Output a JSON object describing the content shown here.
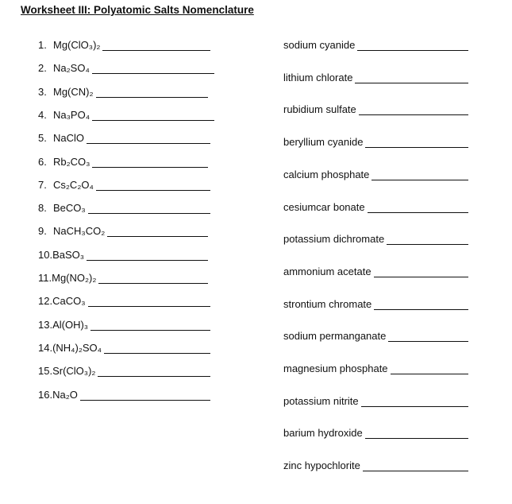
{
  "title": "Worksheet III:  Polyatomic Salts Nomenclature",
  "formulas": [
    {
      "num": "1.",
      "text": "Mg(ClO₃)₂"
    },
    {
      "num": "2.",
      "text": "Na₂SO₄"
    },
    {
      "num": "3.",
      "text": "Mg(CN)₂"
    },
    {
      "num": "4.",
      "text": "Na₃PO₄"
    },
    {
      "num": "5.",
      "text": "NaClO"
    },
    {
      "num": "6.",
      "text": "Rb₂CO₃"
    },
    {
      "num": "7.",
      "text": "Cs₂C₂O₄"
    },
    {
      "num": "8.",
      "text": "BeCO₃"
    },
    {
      "num": "9.",
      "text": "NaCH₃CO₂"
    },
    {
      "num": "10.",
      "text": "BaSO₃"
    },
    {
      "num": "11.",
      "text": "Mg(NO₂)₂"
    },
    {
      "num": "12.",
      "text": "CaCO₃"
    },
    {
      "num": "13.",
      "text": "Al(OH)₃"
    },
    {
      "num": "14.",
      "text": "(NH₄)₂SO₄"
    },
    {
      "num": "15.",
      "text": "Sr(ClO₃)₂"
    },
    {
      "num": "16.",
      "text": "Na₂O"
    }
  ],
  "names": [
    "sodium cyanide",
    "lithium chlorate",
    "rubidium sulfate",
    "beryllium cyanide",
    "calcium phosphate",
    "cesiumcar bonate",
    "potassium dichromate",
    "ammonium acetate",
    "strontium chromate",
    "sodium permanganate",
    "magnesium phosphate",
    "potassium nitrite",
    "barium hydroxide",
    "zinc hypochlorite"
  ]
}
